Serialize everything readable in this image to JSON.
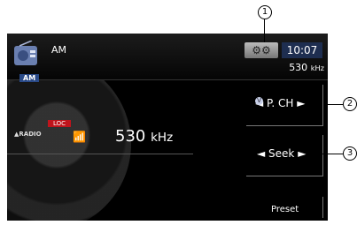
{
  "header": {
    "source_title": "AM",
    "source_badge": "AM",
    "settings_icon": "gear-icon",
    "clock": "10:07",
    "frequency_value": "530",
    "frequency_unit": "kHz"
  },
  "info": {
    "radio_label": "RADIO",
    "loc_badge": "LOC",
    "frequency_value": "530",
    "frequency_unit": "kHz"
  },
  "controls": {
    "pch_label": "◄ P. CH ►",
    "seek_label": "◄ Seek ►",
    "preset_label": "Preset"
  },
  "callouts": {
    "c1": "1",
    "c2": "2",
    "c3": "3"
  },
  "colors": {
    "clock_bg": "#1e2e50",
    "loc_badge": "#c0141c",
    "screen_bg": "#000000"
  }
}
